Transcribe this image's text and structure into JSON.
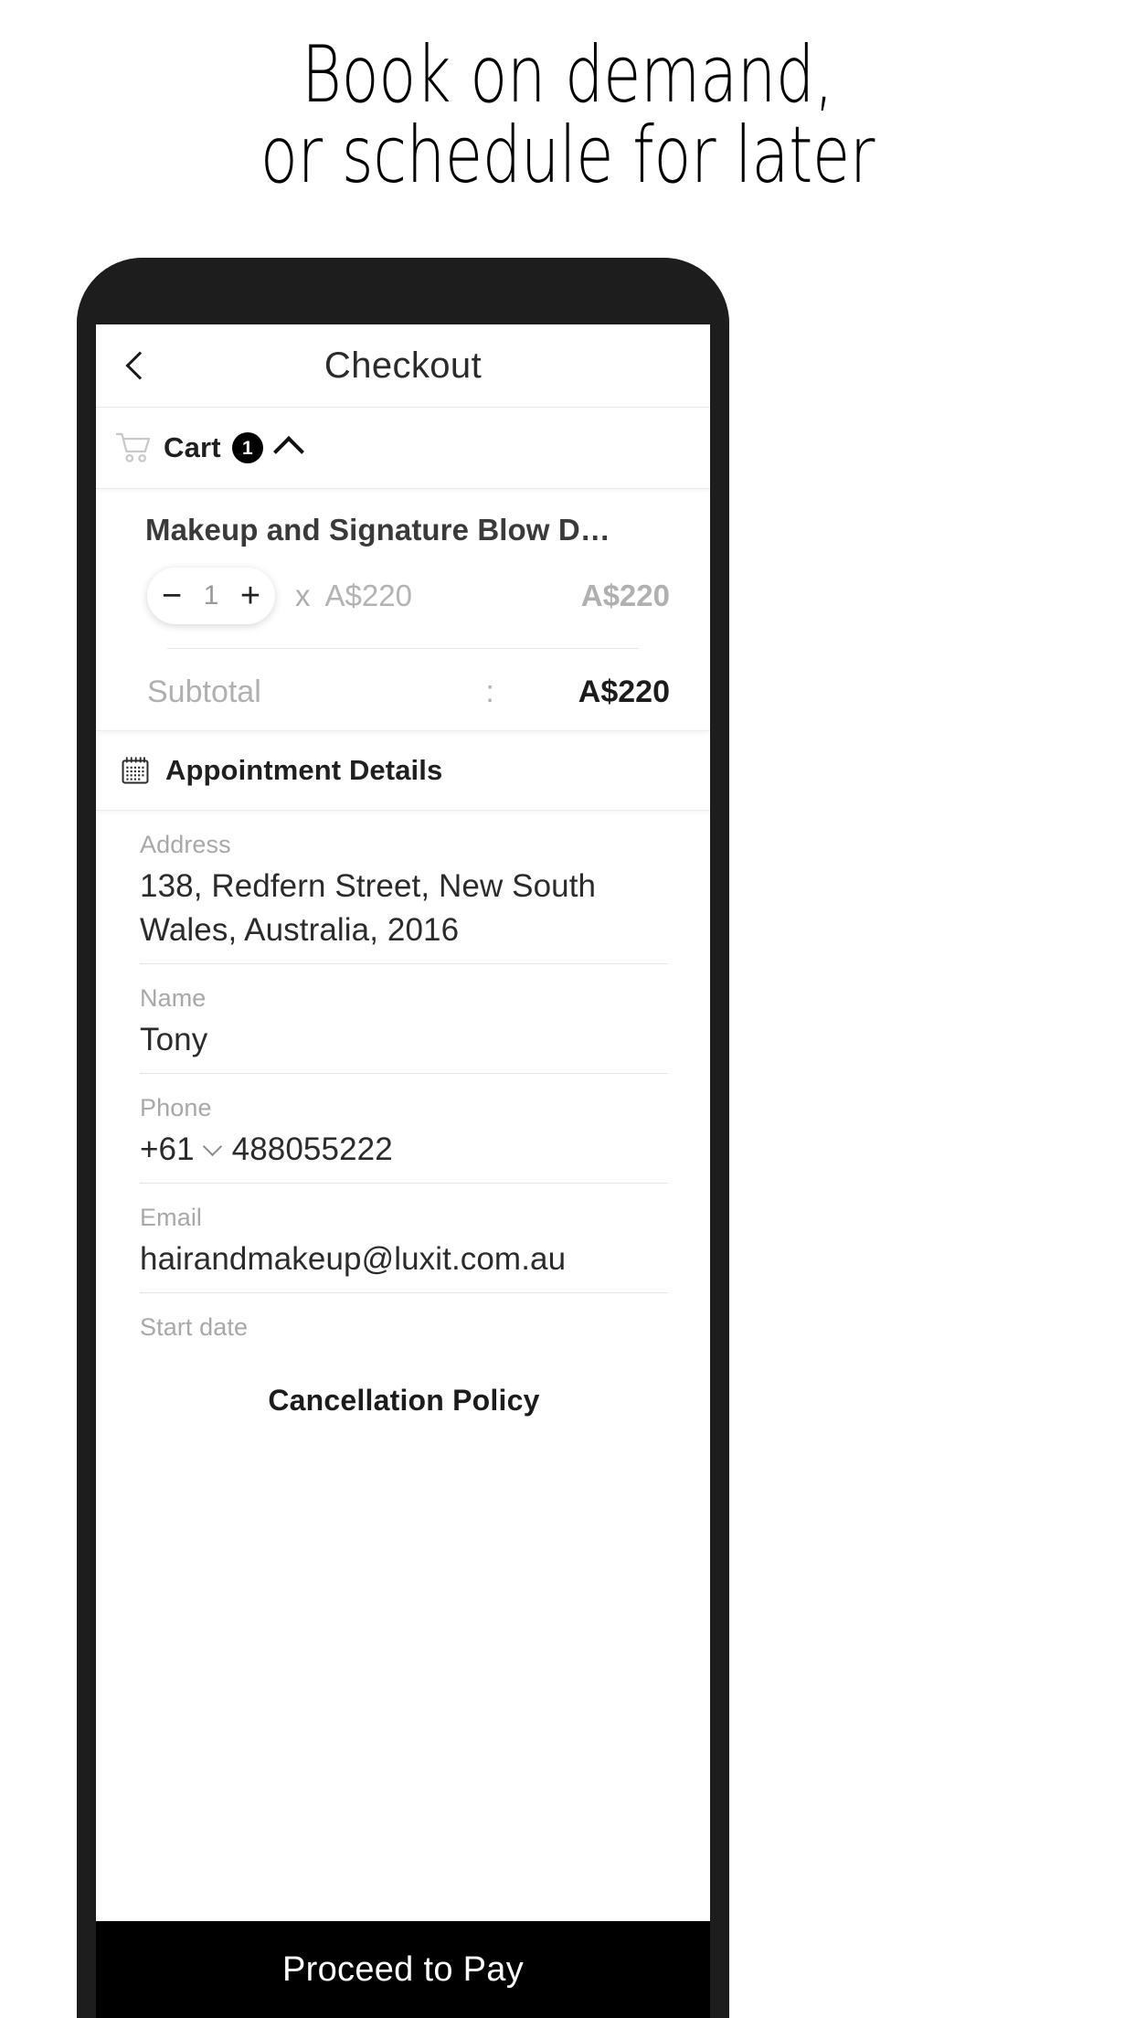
{
  "promo": {
    "headline_line1": "Book on demand,",
    "headline_line2": "or schedule for later"
  },
  "app": {
    "appbar": {
      "back_icon": "chevron-left-icon",
      "title": "Checkout"
    },
    "cart_section": {
      "icon": "shopping-cart-icon",
      "label": "Cart",
      "badge_count": "1",
      "collapse_icon": "chevron-up-icon",
      "item": {
        "title": "Makeup and Signature Blow D…",
        "decrement_label": "−",
        "quantity": "1",
        "increment_label": "+",
        "multiply_symbol": "x",
        "unit_price": "A$220",
        "line_total": "A$220"
      },
      "subtotal_label": "Subtotal",
      "subtotal_separator": ":",
      "subtotal_value": "A$220"
    },
    "appointment_section": {
      "icon": "calendar-icon",
      "label": "Appointment Details",
      "fields": [
        {
          "label": "Address",
          "value": "138, Redfern Street, New South Wales, Australia, 2016"
        },
        {
          "label": "Name",
          "value": "Tony"
        },
        {
          "label": "Phone",
          "country_code": "+61",
          "dropdown_icon": "chevron-down-icon",
          "value": "488055222"
        },
        {
          "label": "Email",
          "value": "hairandmakeup@luxit.com.au"
        },
        {
          "label": "Start date",
          "value": ""
        }
      ]
    },
    "cancellation_policy_label": "Cancellation Policy",
    "pay_button_label": "Proceed to Pay"
  },
  "colors": {
    "device_bezel": "#1d1d1d",
    "pay_button_bg": "#000000",
    "badge_bg": "#000000",
    "muted_text": "#b0b0b0",
    "label_text": "#a8a8a8",
    "value_text": "#2b2b2b"
  }
}
